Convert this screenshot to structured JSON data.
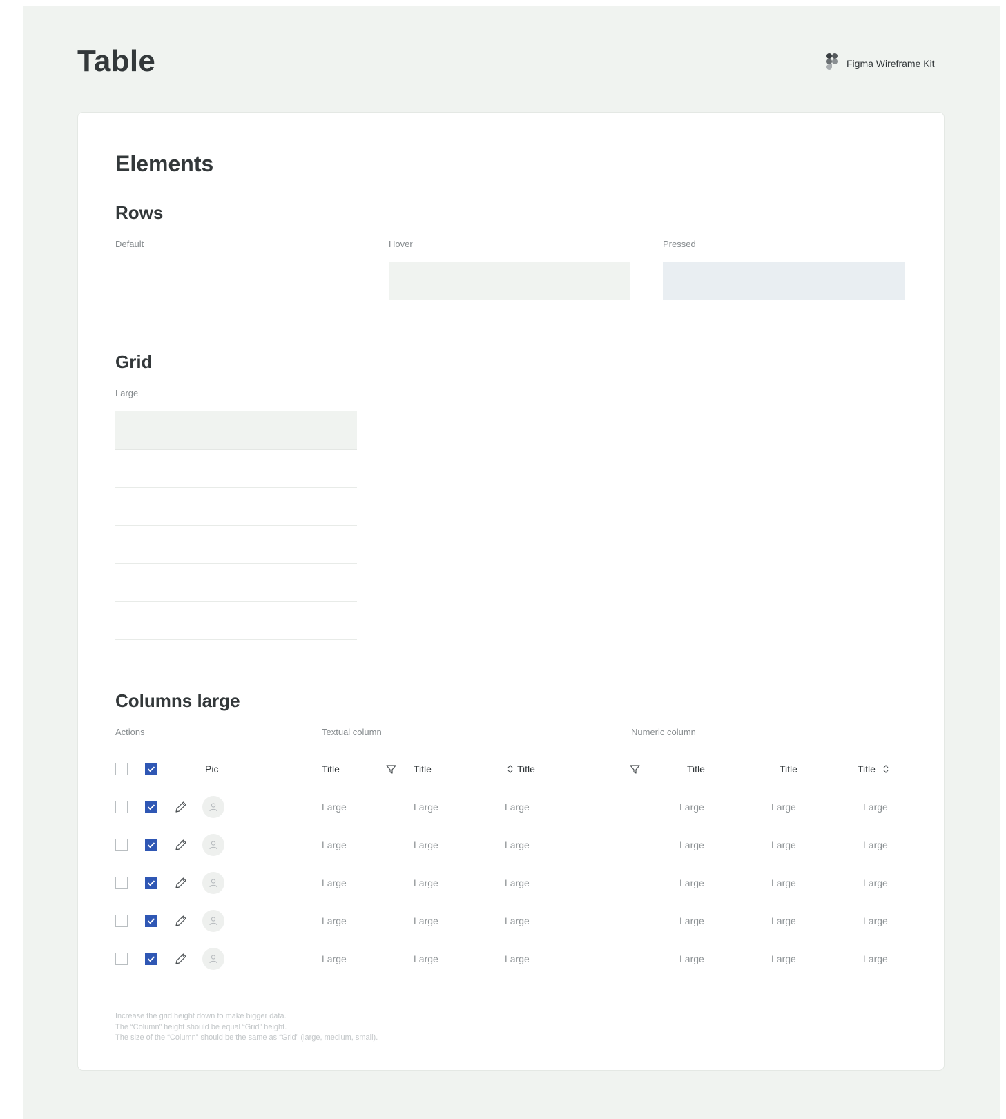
{
  "header": {
    "title": "Table",
    "brand": "Figma Wireframe Kit",
    "brand_icon": "figma-logo-icon"
  },
  "elements": {
    "title": "Elements",
    "rows": {
      "title": "Rows",
      "states": [
        {
          "label": "Default",
          "fill": "#ffffff"
        },
        {
          "label": "Hover",
          "fill": "#f0f3f0"
        },
        {
          "label": "Pressed",
          "fill": "#e9eef2"
        }
      ]
    },
    "grid": {
      "title": "Grid",
      "size_label": "Large"
    },
    "columns": {
      "title": "Columns large",
      "groups": {
        "actions": "Actions",
        "textual": "Textual column",
        "numeric": "Numeric column"
      },
      "headers": {
        "pic": "Pic",
        "text1": "Title",
        "text2": "Title",
        "text3": "Title",
        "num1": "Title",
        "num2": "Title",
        "num3": "Title"
      },
      "rows": [
        {
          "text1": "Large",
          "text2": "Large",
          "text3": "Large",
          "num1": "Large",
          "num2": "Large",
          "num3": "Large"
        },
        {
          "text1": "Large",
          "text2": "Large",
          "text3": "Large",
          "num1": "Large",
          "num2": "Large",
          "num3": "Large"
        },
        {
          "text1": "Large",
          "text2": "Large",
          "text3": "Large",
          "num1": "Large",
          "num2": "Large",
          "num3": "Large"
        },
        {
          "text1": "Large",
          "text2": "Large",
          "text3": "Large",
          "num1": "Large",
          "num2": "Large",
          "num3": "Large"
        },
        {
          "text1": "Large",
          "text2": "Large",
          "text3": "Large",
          "num1": "Large",
          "num2": "Large",
          "num3": "Large"
        }
      ]
    },
    "notes": [
      "Increase the grid height down to make bigger data.",
      "The “Column” height should be equal “Grid” height.",
      "The size of the “Column” should be the same as “Grid” (large, medium, small)."
    ]
  },
  "colors": {
    "background": "#f0f3f0",
    "accent": "#2f57b4"
  }
}
